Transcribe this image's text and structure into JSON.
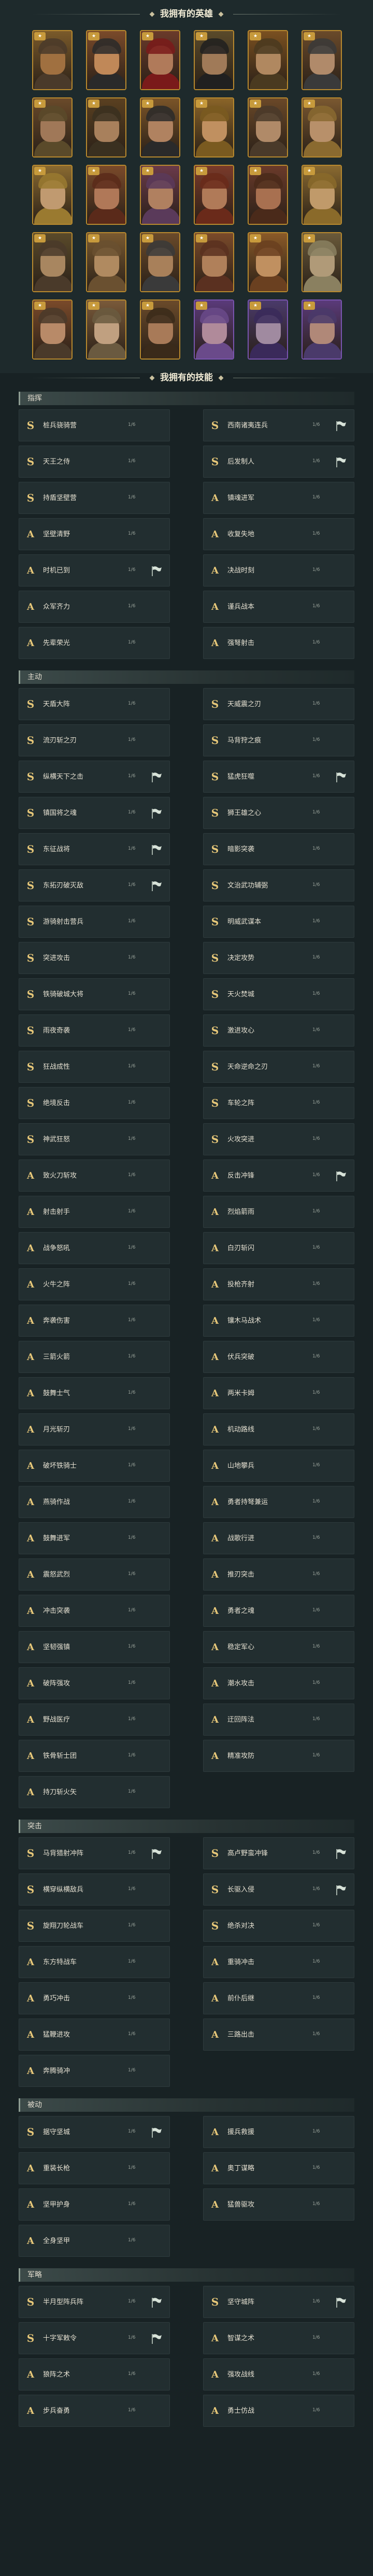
{
  "header": {
    "heroes_title": "我拥有的英雄",
    "skills_title": "我拥有的技能"
  },
  "colors": {
    "bg": "#182224",
    "card": "#222e30",
    "accent": "#e6c779"
  },
  "heroes": [
    {
      "rarity": "gold",
      "palette": [
        "#7a5a2a",
        "#a07040",
        "#4a3a2a"
      ]
    },
    {
      "rarity": "gold",
      "palette": [
        "#7a4a2a",
        "#c08858",
        "#2a2a2a"
      ]
    },
    {
      "rarity": "gold",
      "palette": [
        "#6a3a2a",
        "#b07a5a",
        "#7a1a1a"
      ]
    },
    {
      "rarity": "gold",
      "palette": [
        "#5a4a2a",
        "#a07a58",
        "#202020"
      ]
    },
    {
      "rarity": "gold",
      "palette": [
        "#7a5020",
        "#b08860",
        "#4a3a20"
      ]
    },
    {
      "rarity": "gold",
      "palette": [
        "#6a4a2a",
        "#b08a6a",
        "#3a3a3a"
      ]
    },
    {
      "rarity": "gold",
      "palette": [
        "#6a4a2a",
        "#a07858",
        "#5a4a2a"
      ]
    },
    {
      "rarity": "gold",
      "palette": [
        "#5a4020",
        "#a8805c",
        "#3a3020"
      ]
    },
    {
      "rarity": "gold",
      "palette": [
        "#7a5428",
        "#b08260",
        "#2a2a2a"
      ]
    },
    {
      "rarity": "gold",
      "palette": [
        "#8a6428",
        "#c09060",
        "#7a5a20"
      ]
    },
    {
      "rarity": "gold",
      "palette": [
        "#6a4828",
        "#b08a68",
        "#4a3a2a"
      ]
    },
    {
      "rarity": "gold",
      "palette": [
        "#7a5830",
        "#b8906a",
        "#8a6a30"
      ]
    },
    {
      "rarity": "gold",
      "palette": [
        "#8a6a30",
        "#c09a70",
        "#9a7a30"
      ]
    },
    {
      "rarity": "gold",
      "palette": [
        "#7a4a2a",
        "#b07858",
        "#5a2a1a"
      ]
    },
    {
      "rarity": "gold",
      "palette": [
        "#6a3a4a",
        "#b08060",
        "#5a3a5a"
      ]
    },
    {
      "rarity": "gold",
      "palette": [
        "#7a3a2a",
        "#b07a58",
        "#6a2a1a"
      ]
    },
    {
      "rarity": "gold",
      "palette": [
        "#6a3a2a",
        "#a87050",
        "#4a2a1a"
      ]
    },
    {
      "rarity": "gold",
      "palette": [
        "#8a6a30",
        "#c09a6a",
        "#8a6a2a"
      ]
    },
    {
      "rarity": "gold",
      "palette": [
        "#5a4a2a",
        "#a88660",
        "#4a3a2a"
      ]
    },
    {
      "rarity": "gold",
      "palette": [
        "#7a5a30",
        "#b08a60",
        "#6a5030"
      ]
    },
    {
      "rarity": "gold",
      "palette": [
        "#6a4a2a",
        "#a8805a",
        "#3a3a3a"
      ]
    },
    {
      "rarity": "gold",
      "palette": [
        "#7a4a2a",
        "#b0805a",
        "#5a3020"
      ]
    },
    {
      "rarity": "gold",
      "palette": [
        "#8a5a28",
        "#c09060",
        "#6a4020"
      ]
    },
    {
      "rarity": "gold",
      "palette": [
        "#6a5a3a",
        "#b09a78",
        "#8a8060"
      ]
    },
    {
      "rarity": "gold",
      "palette": [
        "#7a4a2a",
        "#b88a68",
        "#4a3a2a"
      ]
    },
    {
      "rarity": "gold",
      "palette": [
        "#7a5a3a",
        "#c0a080",
        "#6a5a40"
      ]
    },
    {
      "rarity": "gold",
      "palette": [
        "#6a4a2a",
        "#a87a58",
        "#3a2a1a"
      ]
    },
    {
      "rarity": "purple",
      "palette": [
        "#5a3a7a",
        "#b08a9a",
        "#6a4a8a"
      ]
    },
    {
      "rarity": "purple",
      "palette": [
        "#4a3a6a",
        "#a08aa0",
        "#3a2a5a"
      ]
    },
    {
      "rarity": "purple",
      "palette": [
        "#5a3a7a",
        "#b08878",
        "#4a3a6a"
      ]
    }
  ],
  "categories": [
    {
      "label": "指挥",
      "skills": [
        {
          "grade": "S",
          "name": "桩兵骁骑营",
          "tag": "1/6",
          "flag": false
        },
        {
          "grade": "S",
          "name": "西南诸夷连兵",
          "tag": "1/6",
          "flag": true
        },
        {
          "grade": "S",
          "name": "天王之侍",
          "tag": "1/6",
          "flag": false
        },
        {
          "grade": "S",
          "name": "后发制人",
          "tag": "1/6",
          "flag": true
        },
        {
          "grade": "S",
          "name": "持盾坚壁营",
          "tag": "1/6",
          "flag": false
        },
        {
          "grade": "A",
          "name": "镇魂进军",
          "tag": "1/6",
          "flag": false
        },
        {
          "grade": "A",
          "name": "坚壁清野",
          "tag": "1/6",
          "flag": false
        },
        {
          "grade": "A",
          "name": "收复失地",
          "tag": "1/6",
          "flag": false
        },
        {
          "grade": "A",
          "name": "时机已到",
          "tag": "1/6",
          "flag": true
        },
        {
          "grade": "A",
          "name": "决战时刻",
          "tag": "1/6",
          "flag": false
        },
        {
          "grade": "A",
          "name": "众军齐力",
          "tag": "1/6",
          "flag": false
        },
        {
          "grade": "A",
          "name": "谨兵战本",
          "tag": "1/6",
          "flag": false
        },
        {
          "grade": "A",
          "name": "先辈荣光",
          "tag": "1/6",
          "flag": false
        },
        {
          "grade": "A",
          "name": "强弩射击",
          "tag": "1/6",
          "flag": false
        }
      ]
    },
    {
      "label": "主动",
      "skills": [
        {
          "grade": "S",
          "name": "天盾大阵",
          "tag": "1/6",
          "flag": false
        },
        {
          "grade": "S",
          "name": "天威震之刃",
          "tag": "1/6",
          "flag": false
        },
        {
          "grade": "S",
          "name": "流刃斩之刃",
          "tag": "1/6",
          "flag": false
        },
        {
          "grade": "S",
          "name": "马背狩之痕",
          "tag": "1/6",
          "flag": false
        },
        {
          "grade": "S",
          "name": "纵横天下之击",
          "tag": "1/6",
          "flag": true
        },
        {
          "grade": "S",
          "name": "猛虎狂噬",
          "tag": "1/6",
          "flag": true
        },
        {
          "grade": "S",
          "name": "镇国将之魂",
          "tag": "1/6",
          "flag": true
        },
        {
          "grade": "S",
          "name": "狮王雄之心",
          "tag": "1/6",
          "flag": false
        },
        {
          "grade": "S",
          "name": "东征战将",
          "tag": "1/6",
          "flag": true
        },
        {
          "grade": "S",
          "name": "暗影突袭",
          "tag": "1/6",
          "flag": false
        },
        {
          "grade": "S",
          "name": "东拓刃破灭敌",
          "tag": "1/6",
          "flag": true
        },
        {
          "grade": "S",
          "name": "文治武功辅弼",
          "tag": "1/6",
          "flag": false
        },
        {
          "grade": "S",
          "name": "游骑射击营兵",
          "tag": "1/6",
          "flag": false
        },
        {
          "grade": "S",
          "name": "明威武谋本",
          "tag": "1/6",
          "flag": false
        },
        {
          "grade": "S",
          "name": "突进攻击",
          "tag": "1/6",
          "flag": false
        },
        {
          "grade": "S",
          "name": "决定攻势",
          "tag": "1/6",
          "flag": false
        },
        {
          "grade": "S",
          "name": "铁骑破城大将",
          "tag": "1/6",
          "flag": false
        },
        {
          "grade": "S",
          "name": "天火焚城",
          "tag": "1/6",
          "flag": false
        },
        {
          "grade": "S",
          "name": "雨夜奇袭",
          "tag": "1/6",
          "flag": false
        },
        {
          "grade": "S",
          "name": "激进攻心",
          "tag": "1/6",
          "flag": false
        },
        {
          "grade": "S",
          "name": "狂战成性",
          "tag": "1/6",
          "flag": false
        },
        {
          "grade": "S",
          "name": "天命逆命之刃",
          "tag": "1/6",
          "flag": false
        },
        {
          "grade": "S",
          "name": "绝境反击",
          "tag": "1/6",
          "flag": false
        },
        {
          "grade": "S",
          "name": "车轮之阵",
          "tag": "1/6",
          "flag": false
        },
        {
          "grade": "S",
          "name": "神武狂怒",
          "tag": "1/6",
          "flag": false
        },
        {
          "grade": "S",
          "name": "火攻突进",
          "tag": "1/6",
          "flag": false
        },
        {
          "grade": "A",
          "name": "致火刀斩攻",
          "tag": "1/6",
          "flag": false
        },
        {
          "grade": "A",
          "name": "反击冲锋",
          "tag": "1/6",
          "flag": true
        },
        {
          "grade": "A",
          "name": "射击射手",
          "tag": "1/6",
          "flag": false
        },
        {
          "grade": "A",
          "name": "烈焰箭雨",
          "tag": "1/6",
          "flag": false
        },
        {
          "grade": "A",
          "name": "战争怒吼",
          "tag": "1/6",
          "flag": false
        },
        {
          "grade": "A",
          "name": "白刃斩闪",
          "tag": "1/6",
          "flag": false
        },
        {
          "grade": "A",
          "name": "火牛之阵",
          "tag": "1/6",
          "flag": false
        },
        {
          "grade": "A",
          "name": "投枪齐射",
          "tag": "1/6",
          "flag": false
        },
        {
          "grade": "A",
          "name": "奔袭伤害",
          "tag": "1/6",
          "flag": false
        },
        {
          "grade": "A",
          "name": "镶木马战术",
          "tag": "1/6",
          "flag": false
        },
        {
          "grade": "A",
          "name": "三箭火箭",
          "tag": "1/6",
          "flag": false
        },
        {
          "grade": "A",
          "name": "伏兵突破",
          "tag": "1/6",
          "flag": false
        },
        {
          "grade": "A",
          "name": "鼓舞士气",
          "tag": "1/6",
          "flag": false
        },
        {
          "grade": "A",
          "name": "两米卡姆",
          "tag": "1/6",
          "flag": false
        },
        {
          "grade": "A",
          "name": "月光斩刃",
          "tag": "1/6",
          "flag": false
        },
        {
          "grade": "A",
          "name": "机动路线",
          "tag": "1/6",
          "flag": false
        },
        {
          "grade": "A",
          "name": "破坏铁骑士",
          "tag": "1/6",
          "flag": false
        },
        {
          "grade": "A",
          "name": "山地攀兵",
          "tag": "1/6",
          "flag": false
        },
        {
          "grade": "A",
          "name": "燕骑作战",
          "tag": "1/6",
          "flag": false
        },
        {
          "grade": "A",
          "name": "勇者持弩兼运",
          "tag": "1/6",
          "flag": false
        },
        {
          "grade": "A",
          "name": "鼓舞进军",
          "tag": "1/6",
          "flag": false
        },
        {
          "grade": "A",
          "name": "战歌行进",
          "tag": "1/6",
          "flag": false
        },
        {
          "grade": "A",
          "name": "震怒武烈",
          "tag": "1/6",
          "flag": false
        },
        {
          "grade": "A",
          "name": "推刃突击",
          "tag": "1/6",
          "flag": false
        },
        {
          "grade": "A",
          "name": "冲击突袭",
          "tag": "1/6",
          "flag": false
        },
        {
          "grade": "A",
          "name": "勇者之魂",
          "tag": "1/6",
          "flag": false
        },
        {
          "grade": "A",
          "name": "坚韧强镇",
          "tag": "1/6",
          "flag": false
        },
        {
          "grade": "A",
          "name": "稳定军心",
          "tag": "1/6",
          "flag": false
        },
        {
          "grade": "A",
          "name": "破阵强攻",
          "tag": "1/6",
          "flag": false
        },
        {
          "grade": "A",
          "name": "潮水攻击",
          "tag": "1/6",
          "flag": false
        },
        {
          "grade": "A",
          "name": "野战医疗",
          "tag": "1/6",
          "flag": false
        },
        {
          "grade": "A",
          "name": "迂回阵法",
          "tag": "1/6",
          "flag": false
        },
        {
          "grade": "A",
          "name": "铁骨斩士团",
          "tag": "1/6",
          "flag": false
        },
        {
          "grade": "A",
          "name": "精准攻防",
          "tag": "1/6",
          "flag": false
        },
        {
          "grade": "A",
          "name": "持刀斩火矢",
          "tag": "1/6",
          "flag": false
        }
      ]
    },
    {
      "label": "突击",
      "skills": [
        {
          "grade": "S",
          "name": "马背猎射冲阵",
          "tag": "1/6",
          "flag": true
        },
        {
          "grade": "S",
          "name": "高卢野蛮冲锋",
          "tag": "1/6",
          "flag": true
        },
        {
          "grade": "S",
          "name": "横穿纵横敌兵",
          "tag": "1/6",
          "flag": false
        },
        {
          "grade": "S",
          "name": "长驱入侵",
          "tag": "1/6",
          "flag": true
        },
        {
          "grade": "S",
          "name": "旋翔刀轮战车",
          "tag": "1/6",
          "flag": false
        },
        {
          "grade": "S",
          "name": "绝杀对决",
          "tag": "1/6",
          "flag": false
        },
        {
          "grade": "A",
          "name": "东方特战车",
          "tag": "1/6",
          "flag": false
        },
        {
          "grade": "A",
          "name": "重骑冲击",
          "tag": "1/6",
          "flag": false
        },
        {
          "grade": "A",
          "name": "勇巧冲击",
          "tag": "1/6",
          "flag": false
        },
        {
          "grade": "A",
          "name": "前仆后继",
          "tag": "1/6",
          "flag": false
        },
        {
          "grade": "A",
          "name": "猛鞭进攻",
          "tag": "1/6",
          "flag": false
        },
        {
          "grade": "A",
          "name": "三路出击",
          "tag": "1/6",
          "flag": false
        },
        {
          "grade": "A",
          "name": "奔腾骑冲",
          "tag": "1/6",
          "flag": false
        }
      ]
    },
    {
      "label": "被动",
      "skills": [
        {
          "grade": "S",
          "name": "据守坚城",
          "tag": "1/6",
          "flag": true
        },
        {
          "grade": "A",
          "name": "援兵救援",
          "tag": "1/6",
          "flag": false
        },
        {
          "grade": "A",
          "name": "重装长枪",
          "tag": "1/6",
          "flag": false
        },
        {
          "grade": "A",
          "name": "奥丁谋略",
          "tag": "1/6",
          "flag": false
        },
        {
          "grade": "A",
          "name": "坚甲护身",
          "tag": "1/6",
          "flag": false
        },
        {
          "grade": "A",
          "name": "猛兽驱攻",
          "tag": "1/6",
          "flag": false
        },
        {
          "grade": "A",
          "name": "全身坚甲",
          "tag": "1/6",
          "flag": false
        }
      ]
    },
    {
      "label": "军略",
      "skills": [
        {
          "grade": "S",
          "name": "半月型阵兵阵",
          "tag": "1/6",
          "flag": true
        },
        {
          "grade": "S",
          "name": "坚守城阵",
          "tag": "1/6",
          "flag": true
        },
        {
          "grade": "S",
          "name": "十字军敕令",
          "tag": "1/6",
          "flag": true
        },
        {
          "grade": "A",
          "name": "智谋之术",
          "tag": "1/6",
          "flag": false
        },
        {
          "grade": "A",
          "name": "狼阵之术",
          "tag": "1/6",
          "flag": false
        },
        {
          "grade": "A",
          "name": "强攻战线",
          "tag": "1/6",
          "flag": false
        },
        {
          "grade": "A",
          "name": "步兵奋勇",
          "tag": "1/6",
          "flag": false
        },
        {
          "grade": "A",
          "name": "勇士仿战",
          "tag": "1/6",
          "flag": false
        }
      ]
    }
  ]
}
